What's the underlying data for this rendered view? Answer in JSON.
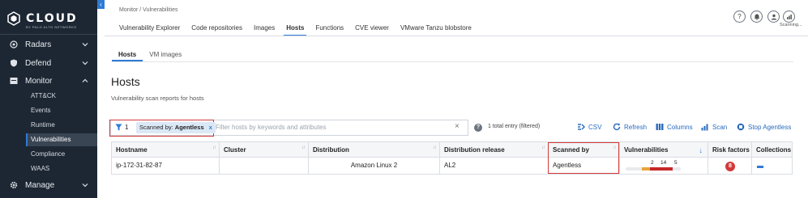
{
  "sidebar": {
    "logo_text": "CLOUD",
    "logo_sub": "BY PALO ALTO NETWORKS",
    "items": [
      {
        "label": "Radars",
        "icon": "radar-icon"
      },
      {
        "label": "Defend",
        "icon": "shield-icon"
      },
      {
        "label": "Monitor",
        "icon": "monitor-icon"
      },
      {
        "label": "Manage",
        "icon": "gear-icon"
      }
    ],
    "monitor_sub": [
      "ATT&CK",
      "Events",
      "Runtime",
      "Vulnerabilities",
      "Compliance",
      "WAAS"
    ],
    "active_sub": "Vulnerabilities"
  },
  "header": {
    "breadcrumb": "Monitor / Vulnerabilities",
    "tabs": [
      "Vulnerability Explorer",
      "Code repositories",
      "Images",
      "Hosts",
      "Functions",
      "CVE viewer",
      "VMware Tanzu blobstore"
    ],
    "active_tab": "Hosts",
    "scanning_label": "Scanning..."
  },
  "subtabs": [
    "Hosts",
    "VM images"
  ],
  "page": {
    "title": "Hosts",
    "description": "Vulnerability scan reports for hosts"
  },
  "filter": {
    "count": "1",
    "chip_key": "Scanned by:",
    "chip_value": "Agentless",
    "chip_close": "x",
    "placeholder": "Filter hosts by keywords and attributes",
    "clear": "×",
    "help": "?",
    "total": "1 total entry (filtered)"
  },
  "actions": {
    "csv": "CSV",
    "refresh": "Refresh",
    "columns": "Columns",
    "scan": "Scan",
    "stop": "Stop Agentless"
  },
  "table": {
    "columns": [
      "Hostname",
      "Cluster",
      "Distribution",
      "Distribution release",
      "Scanned by",
      "Vulnerabilities",
      "Risk factors",
      "Collections"
    ],
    "rows": [
      {
        "hostname": "ip-172-31-82-87",
        "cluster": "",
        "distribution": "Amazon Linux 2",
        "release": "AL2",
        "scanned_by": "Agentless",
        "vulns": {
          "critical": "2",
          "high": "14",
          "medium": "5"
        },
        "risk_factors": "8"
      }
    ]
  },
  "colors": {
    "accent": "#2e7bd6",
    "highlight": "#d23a3a",
    "sidebar_bg": "#1d2733"
  }
}
